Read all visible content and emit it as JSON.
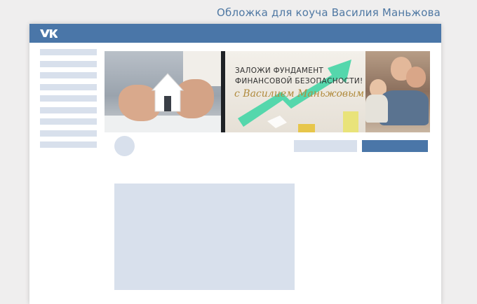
{
  "caption": "Обложка для коуча Василия Маньжова",
  "topbar": {
    "logo_icon": "vk-logo-icon",
    "color": "#4a76a8"
  },
  "sidebar": {
    "item_count": 9,
    "placeholder_color": "#d8e0ec"
  },
  "cover": {
    "headline_line1": "ЗАЛОЖИ ФУНДАМЕНТ",
    "headline_line2": "ФИНАНСОВОЙ БЕЗОПАСНОСТИ!",
    "signature": "с Василием Маньжовым",
    "accent_color": "#4fd4a8",
    "signature_color": "#b08a3c"
  }
}
